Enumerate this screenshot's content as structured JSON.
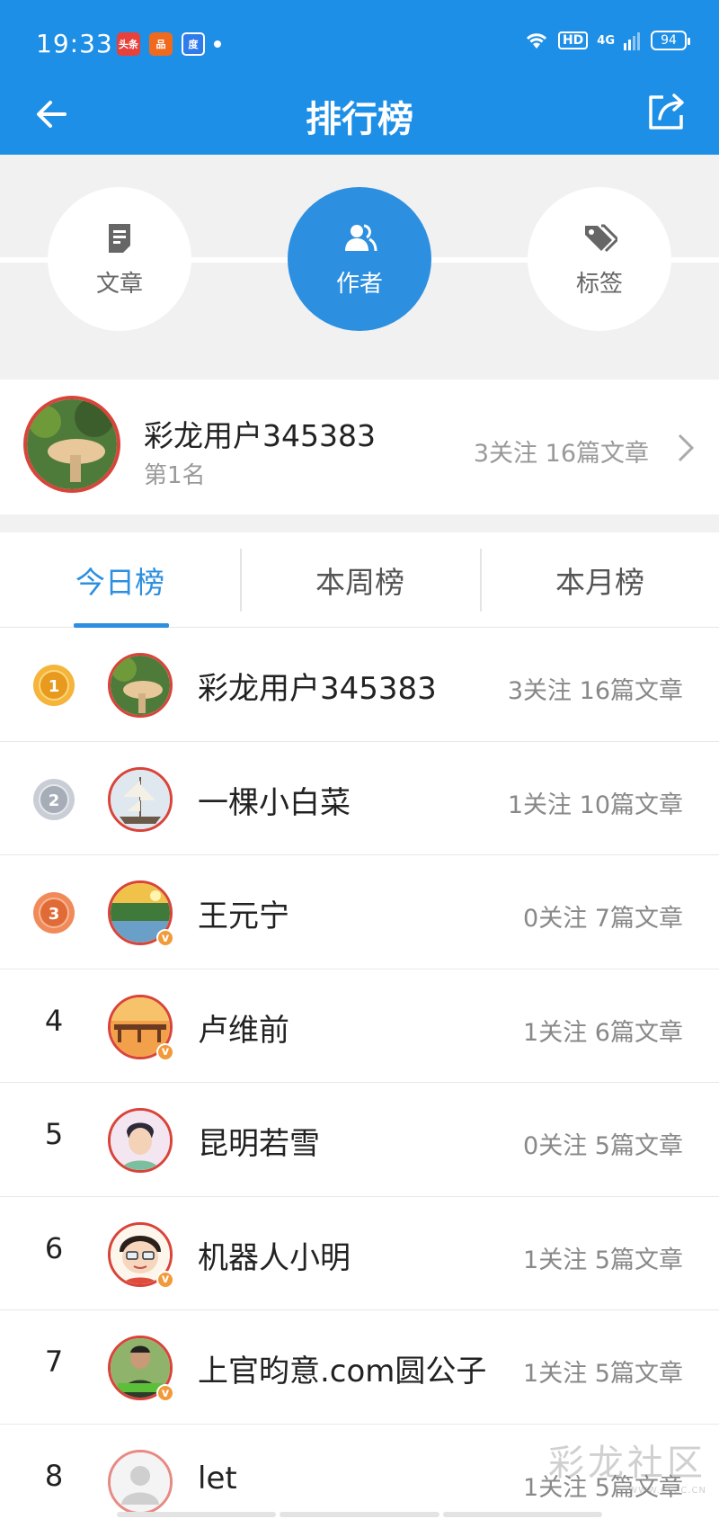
{
  "status_bar": {
    "time": "19:33",
    "app_icons": [
      "头条",
      "品",
      "度"
    ],
    "hd": "HD",
    "network": "4G",
    "battery": "94"
  },
  "header": {
    "title": "排行榜",
    "back_icon": "back-arrow-icon",
    "share_icon": "share-icon",
    "background_color": "#1e8fe6"
  },
  "categories": [
    {
      "label": "文章",
      "icon": "document-icon",
      "active": false
    },
    {
      "label": "作者",
      "icon": "users-icon",
      "active": true
    },
    {
      "label": "标签",
      "icon": "tags-icon",
      "active": false
    }
  ],
  "top_user": {
    "name": "彩龙用户345383",
    "rank": "第1名",
    "stats": "3关注 16篇文章"
  },
  "tabs": [
    {
      "label": "今日榜",
      "active": true
    },
    {
      "label": "本周榜",
      "active": false
    },
    {
      "label": "本月榜",
      "active": false
    }
  ],
  "rankings": [
    {
      "rank": "1",
      "medal": "gold",
      "name": "彩龙用户345383",
      "meta": "3关注 16篇文章",
      "verified": false
    },
    {
      "rank": "2",
      "medal": "silver",
      "name": "一棵小白菜",
      "meta": "1关注 10篇文章",
      "verified": false
    },
    {
      "rank": "3",
      "medal": "bronze",
      "name": "王元宁",
      "meta": "0关注 7篇文章",
      "verified": true
    },
    {
      "rank": "4",
      "medal": "",
      "name": "卢维前",
      "meta": "1关注 6篇文章",
      "verified": true
    },
    {
      "rank": "5",
      "medal": "",
      "name": "昆明若雪",
      "meta": "0关注 5篇文章",
      "verified": false
    },
    {
      "rank": "6",
      "medal": "",
      "name": "机器人小明",
      "meta": "1关注 5篇文章",
      "verified": true
    },
    {
      "rank": "7",
      "medal": "",
      "name": "上官昀意.com圆公子",
      "meta": "1关注 5篇文章",
      "verified": true
    },
    {
      "rank": "8",
      "medal": "",
      "name": "let",
      "meta": "1关注 5篇文章",
      "verified": false
    }
  ],
  "verified_badge": "v",
  "watermark": {
    "text": "彩龙社区",
    "sub": "WWW.CLZC.CN"
  },
  "colors": {
    "accent": "#2c8fe0",
    "avatar_ring": "#d9443a",
    "verified": "#f29a3a"
  }
}
